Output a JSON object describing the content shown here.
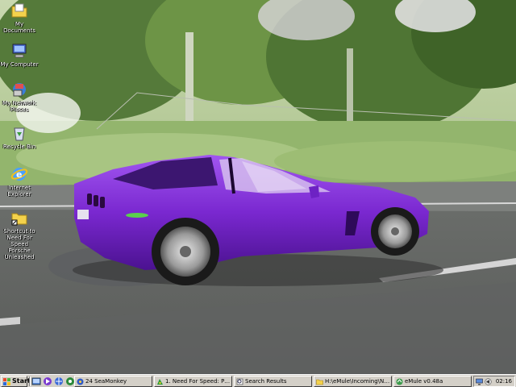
{
  "desktop": {
    "icons": [
      {
        "label": "My Documents",
        "icon": "folder-documents-icon"
      },
      {
        "label": "My Computer",
        "icon": "computer-icon"
      },
      {
        "label": "My Network Places",
        "icon": "network-places-icon"
      },
      {
        "label": "Recycle Bin",
        "icon": "recycle-bin-icon"
      },
      {
        "label": "Internet Explorer",
        "icon": "internet-explorer-icon"
      },
      {
        "label": "Shortcut to Need For Speed Porsche Unleashed",
        "icon": "folder-shortcut-icon"
      }
    ],
    "wallpaper": "purple corvette on road"
  },
  "taskbar": {
    "start_label": "Start",
    "quick_launch": [
      "show-desktop-icon",
      "media-player-icon",
      "browser-icon",
      "network-icon"
    ],
    "tasks": [
      {
        "label": "24 SeaMonkey",
        "icon": "seamonkey-icon"
      },
      {
        "label": "1. Need For Speed: Por...",
        "icon": "nfs-icon"
      },
      {
        "label": "Search Results",
        "icon": "search-results-icon"
      },
      {
        "label": "H:\\eMule\\Incoming\\Nee...",
        "icon": "folder-icon"
      },
      {
        "label": "eMule v0.48a",
        "icon": "emule-icon"
      }
    ],
    "clock": "02:16"
  },
  "colors": {
    "car": "#7b2fd0",
    "taskbar": "#d4d0c8"
  }
}
